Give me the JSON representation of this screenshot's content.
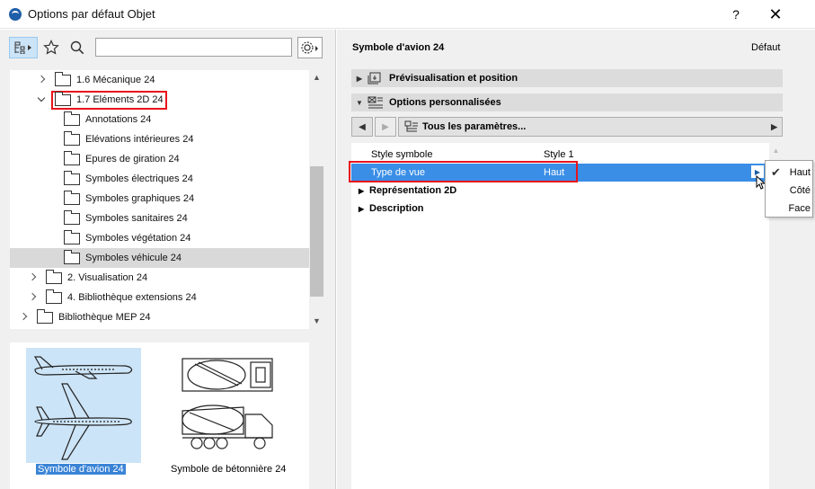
{
  "window": {
    "title": "Options par défaut Objet",
    "help_label": "?",
    "close_label": "✕"
  },
  "left_toolbar": {
    "nav_icon": "folder-tree-icon",
    "star_icon": "star-icon",
    "search_icon": "search-icon",
    "search_placeholder": "",
    "search_value": "",
    "gear_icon": "gear-icon"
  },
  "tree": {
    "items": [
      {
        "label": "1.6 Mécanique 24",
        "expander": "right"
      },
      {
        "label": "1.7 Eléments 2D 24",
        "expander": "down",
        "highlighted": true
      },
      {
        "label": "Annotations 24"
      },
      {
        "label": "Elévations intérieures 24"
      },
      {
        "label": "Epures de giration 24"
      },
      {
        "label": "Symboles électriques 24"
      },
      {
        "label": "Symboles graphiques 24"
      },
      {
        "label": "Symboles sanitaires 24"
      },
      {
        "label": "Symboles végétation 24"
      },
      {
        "label": "Symboles véhicule 24",
        "selected": true
      },
      {
        "label": "2. Visualisation 24",
        "expander": "right"
      },
      {
        "label": "4. Bibliothèque extensions 24",
        "expander": "right"
      },
      {
        "label": "Bibliothèque MEP 24",
        "expander": "right"
      }
    ]
  },
  "preview": {
    "items": [
      {
        "label": "Symbole d'avion 24",
        "selected": true,
        "icon": "airplane-icon"
      },
      {
        "label": "Symbole de bétonnière 24",
        "selected": false,
        "icon": "cement-mixer-icon"
      }
    ]
  },
  "right": {
    "title": "Symbole d'avion 24",
    "default_label": "Défaut",
    "sections": [
      {
        "label": "Prévisualisation et position",
        "icon": "preview-position-icon"
      },
      {
        "label": "Options personnalisées",
        "icon": "custom-options-icon"
      }
    ],
    "nav": {
      "prev_icon": "triangle-left-icon",
      "next_icon": "triangle-right-icon",
      "select_label": "Tous les paramètres...",
      "select_icon": "parameters-icon"
    },
    "params": [
      {
        "name": "Style symbole",
        "value": "Style 1"
      },
      {
        "name": "Type de vue",
        "value": "Haut",
        "active": true
      }
    ],
    "groups": [
      {
        "name": "Représentation 2D"
      },
      {
        "name": "Description"
      }
    ]
  },
  "dropdown": {
    "options": [
      "Haut",
      "Côté",
      "Face"
    ],
    "selected": "Haut"
  },
  "colors": {
    "selection_blue": "#3a8ee6",
    "highlight_red": "#e8141c",
    "tile_selected": "#cce4f7"
  }
}
